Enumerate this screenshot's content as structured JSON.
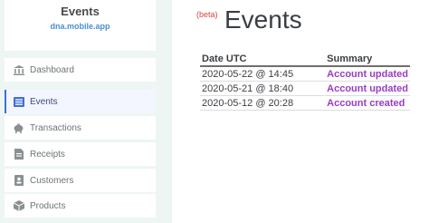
{
  "app": {
    "title": "Events",
    "subtitle": "dna.mobile.app"
  },
  "sidebar": {
    "items": [
      {
        "label": "Dashboard",
        "icon": "bank-icon",
        "active": false
      },
      {
        "label": "Events",
        "icon": "list-icon",
        "active": true
      },
      {
        "label": "Transactions",
        "icon": "piggy-bank-icon",
        "active": false
      },
      {
        "label": "Receipts",
        "icon": "receipt-icon",
        "active": false
      },
      {
        "label": "Customers",
        "icon": "id-card-icon",
        "active": false
      },
      {
        "label": "Products",
        "icon": "box-icon",
        "active": false
      }
    ]
  },
  "main": {
    "beta": "(beta)",
    "heading": "Events",
    "table": {
      "headers": [
        "Date UTC",
        "Summary"
      ],
      "rows": [
        {
          "date": "2020-05-22 @ 14:45",
          "summary": "Account updated"
        },
        {
          "date": "2020-05-21 @ 18:40",
          "summary": "Account updated"
        },
        {
          "date": "2020-05-12 @ 20:28",
          "summary": "Account created"
        }
      ]
    }
  },
  "colors": {
    "sidebar_bg": "#eef6f4",
    "accent": "#3f6fd8",
    "summary_purple": "#9a3dc4",
    "beta_red": "#d6453d",
    "subtitle_blue": "#4a8fd0"
  }
}
